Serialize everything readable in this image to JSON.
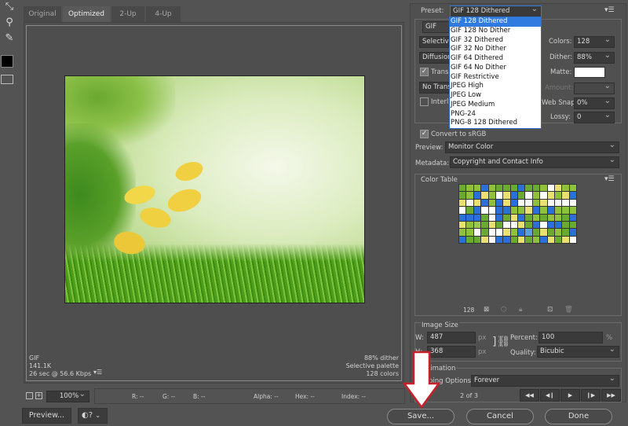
{
  "tools": [
    {
      "icon": "slice-select-icon"
    },
    {
      "icon": "zoom-icon"
    },
    {
      "icon": "eyedropper-icon"
    },
    {
      "icon": "eyedropper-color-swatch"
    },
    {
      "icon": "toggle-slices-icon"
    }
  ],
  "tabs": [
    "Original",
    "Optimized",
    "2-Up",
    "4-Up"
  ],
  "active_tab": "Optimized",
  "info_left": {
    "format": "GIF",
    "size": "141.1K",
    "time": "26 sec @ 56.6 Kbps"
  },
  "info_right": {
    "dither": "88% dither",
    "palette": "Selective palette",
    "colors": "128 colors"
  },
  "statusbar": {
    "zoom": "100%",
    "r": "R: --",
    "g": "G: --",
    "b": "B: --",
    "alpha": "Alpha: --",
    "hex": "Hex: --",
    "index": "Index: --"
  },
  "bottom_buttons": {
    "preview": "Preview...",
    "save": "Save...",
    "cancel": "Cancel",
    "done": "Done"
  },
  "settings": {
    "preset_label": "Preset:",
    "preset": "GIF 128 Dithered",
    "preset_options": [
      "GIF 128 Dithered",
      "GIF 128 No Dither",
      "GIF 32 Dithered",
      "GIF 32 No Dither",
      "GIF 64 Dithered",
      "GIF 64 No Dither",
      "GIF Restrictive",
      "JPEG High",
      "JPEG Low",
      "JPEG Medium",
      "PNG-24",
      "PNG-8 128 Dithered"
    ],
    "format": "GIF",
    "reduction": "Selective",
    "dither_algo": "Diffusion",
    "transparency": "Transparency",
    "transparency_checked": true,
    "transp_dither": "No Transparency Dither",
    "interlaced": "Interlaced",
    "interlaced_checked": false,
    "colors_label": "Colors:",
    "colors": "128",
    "dither_label": "Dither:",
    "dither": "88%",
    "matte_label": "Matte:",
    "matte_color": "#ffffff",
    "amount_label": "Amount:",
    "websnap_label": "Web Snap:",
    "websnap": "0%",
    "lossy_label": "Lossy:",
    "lossy": "0",
    "srgb": "Convert to sRGB",
    "srgb_checked": true,
    "preview_label": "Preview:",
    "preview": "Monitor Color",
    "metadata_label": "Metadata:",
    "metadata": "Copyright and Contact Info"
  },
  "color_table": {
    "title": "Color Table",
    "count": "128",
    "palette": [
      "#8fc23a",
      "#5aa0e0",
      "#3d7a1e",
      "#a8d060",
      "#e8e070",
      "#f0c030",
      "#c8e8a0",
      "#7ab040",
      "#ffffff",
      "#5a9a28",
      "#b8e0f0",
      "#4e8a20",
      "#2a70d8",
      "#9cc850",
      "#d8e890",
      "#f0a040",
      "#6aaa30",
      "#c0d870",
      "#e0f0c0",
      "#88b848"
    ]
  },
  "image_size": {
    "title": "Image Size",
    "w_label": "W:",
    "w": "487",
    "h_label": "H:",
    "h": "368",
    "unit": "px",
    "percent_label": "Percent:",
    "percent": "100",
    "percent_unit": "%",
    "quality_label": "Quality:",
    "quality": "Bicubic"
  },
  "animation": {
    "title": "Animation",
    "looping_label": "Looping Options:",
    "looping": "Forever",
    "frame": "2 of 3"
  }
}
